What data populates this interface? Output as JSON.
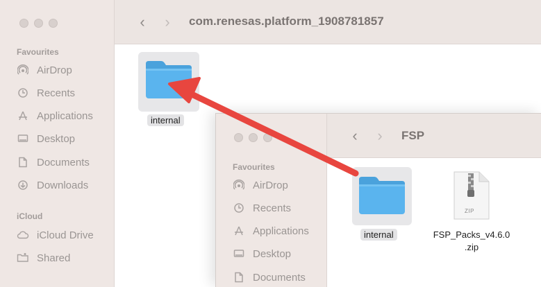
{
  "back_window": {
    "title": "com.renesas.platform_1908781857",
    "sidebar": {
      "favourites_label": "Favourites",
      "favourites": [
        {
          "label": "AirDrop",
          "icon": "airdrop-icon"
        },
        {
          "label": "Recents",
          "icon": "clock-icon"
        },
        {
          "label": "Applications",
          "icon": "applications-icon"
        },
        {
          "label": "Desktop",
          "icon": "desktop-icon"
        },
        {
          "label": "Documents",
          "icon": "document-icon"
        },
        {
          "label": "Downloads",
          "icon": "download-icon"
        }
      ],
      "icloud_label": "iCloud",
      "icloud": [
        {
          "label": "iCloud Drive",
          "icon": "cloud-icon"
        },
        {
          "label": "Shared",
          "icon": "shared-folder-icon"
        }
      ]
    },
    "items": [
      {
        "name": "internal",
        "type": "folder"
      }
    ]
  },
  "front_window": {
    "title": "FSP",
    "sidebar": {
      "favourites_label": "Favourites",
      "favourites": [
        {
          "label": "AirDrop",
          "icon": "airdrop-icon"
        },
        {
          "label": "Recents",
          "icon": "clock-icon"
        },
        {
          "label": "Applications",
          "icon": "applications-icon"
        },
        {
          "label": "Desktop",
          "icon": "desktop-icon"
        },
        {
          "label": "Documents",
          "icon": "document-icon"
        }
      ]
    },
    "items": [
      {
        "name": "internal",
        "type": "folder"
      },
      {
        "name_line1": "FSP_Packs_v4.6.0",
        "name_line2": ".zip",
        "type": "zip",
        "badge": "ZIP"
      }
    ]
  },
  "annotation": {
    "type": "arrow",
    "color": "#e8463f"
  },
  "colors": {
    "folder": "#5ab4ee",
    "folder_tab": "#4aa2dc",
    "sidebar_bg": "#efe7e4",
    "arrow": "#e8463f"
  }
}
